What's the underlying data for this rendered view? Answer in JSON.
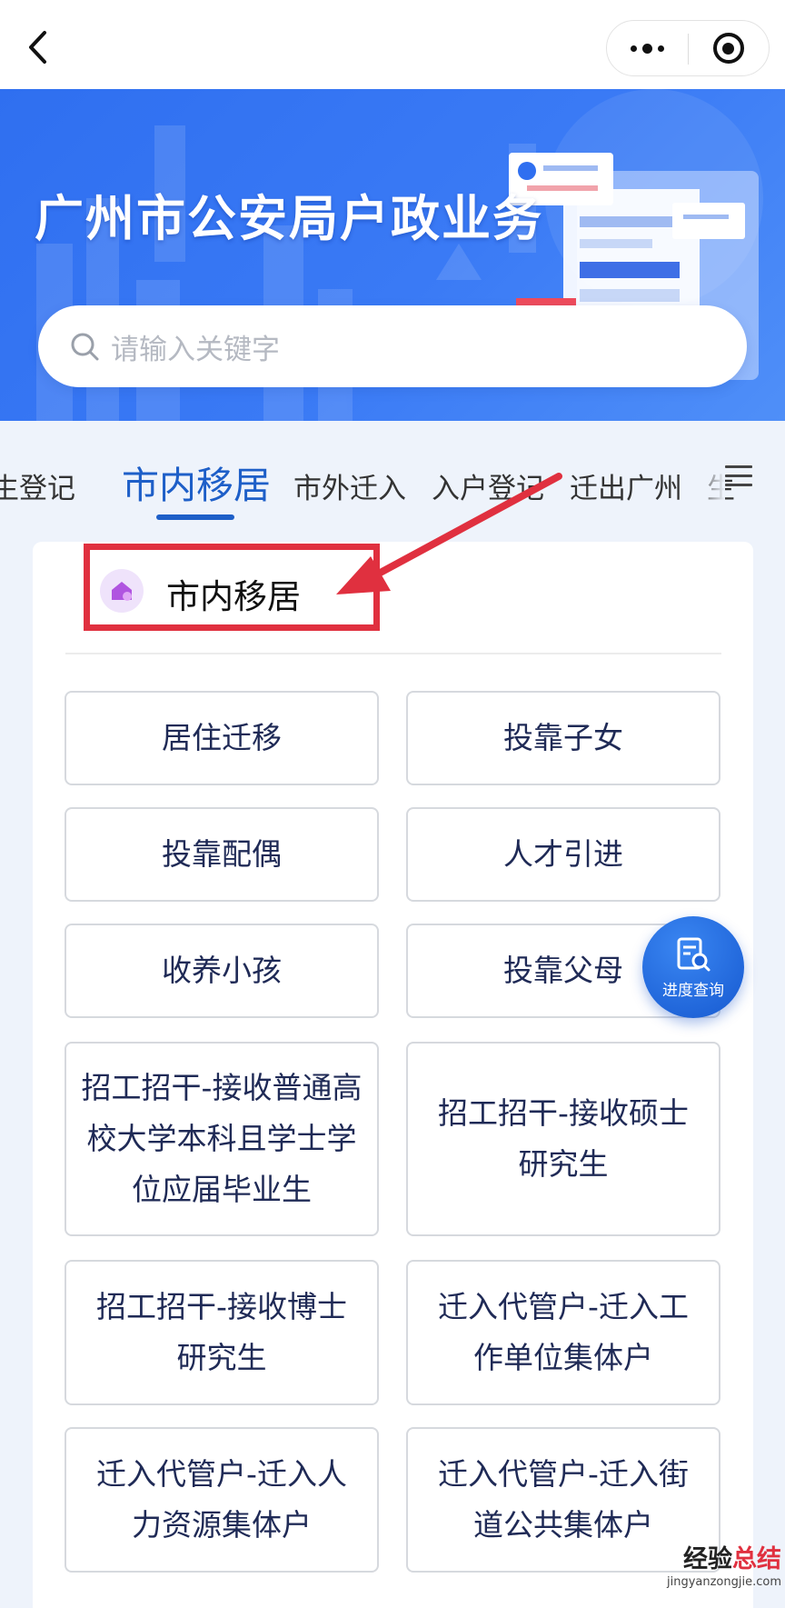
{
  "header": {
    "back_icon": "chevron-left-icon",
    "more_icon": "more-dots-icon",
    "close_icon": "target-icon"
  },
  "banner": {
    "title": "广州市公安局户政业务"
  },
  "search": {
    "placeholder": "请输入关键字",
    "icon": "search-icon"
  },
  "tabs": [
    {
      "label": "生登记",
      "active": false
    },
    {
      "label": "市内移居",
      "active": true
    },
    {
      "label": "市外迁入",
      "active": false
    },
    {
      "label": "入户登记",
      "active": false
    },
    {
      "label": "迁出广州",
      "active": false
    },
    {
      "label": "生",
      "active": false
    }
  ],
  "tabs_menu_icon": "menu-icon",
  "section": {
    "title": "市内移居",
    "icon": "home-icon",
    "accent_color": "#e0303f"
  },
  "services": [
    "居住迁移",
    "投靠子女",
    "投靠配偶",
    "人才引进",
    "收养小孩",
    "投靠父母",
    "招工招干-接收普通高校大学本科且学士学位应届毕业生",
    "招工招干-接收硕士研究生",
    "招工招干-接收博士研究生",
    "迁入代管户-迁入工作单位集体户",
    "迁入代管户-迁入人力资源集体户",
    "迁入代管户-迁入街道公共集体户"
  ],
  "fab": {
    "label": "进度查询",
    "icon": "document-search-icon"
  },
  "watermark": {
    "part1": "经验",
    "part2": "总结",
    "url": "jingyanzongjie.com"
  },
  "colors": {
    "primary": "#1e5fc8",
    "banner": "#3a7af5",
    "highlight": "#e0303f"
  }
}
